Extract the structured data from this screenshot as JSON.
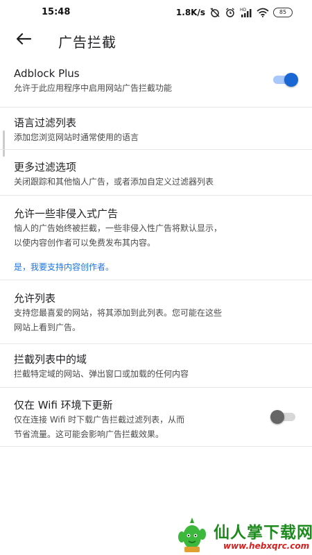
{
  "status_bar": {
    "time": "15:48",
    "net_speed": "1.8K/s",
    "battery_level": "85",
    "signal_label": "4G"
  },
  "header": {
    "title": "广告拦截"
  },
  "settings": {
    "adblock": {
      "title": "Adblock Plus",
      "description": "允许于此应用程序中启用网站广告拦截功能",
      "enabled": true
    },
    "language_filters": {
      "title": "语言过滤列表",
      "description": "添加您浏览网站时通常使用的语言"
    },
    "more_filters": {
      "title": "更多过滤选项",
      "description": "关闭跟踪和其他恼人广告，或者添加自定义过滤器列表"
    },
    "acceptable_ads": {
      "title": "允许一些非侵入式广告",
      "description_line1": "恼人的广告始终被拦截，一些非侵入性广告将默认显示，",
      "description_line2": "以使内容创作者可以免费发布其内容。",
      "link": "是，我要支持内容创作者。"
    },
    "allowlist": {
      "title": "允许列表",
      "description_line1": "支持您最喜爱的网站，将其添加到此列表。您可能在这些",
      "description_line2": "网站上看到广告。"
    },
    "blocked_domains": {
      "title": "拦截列表中的域",
      "description": "拦截特定域的网站、弹出窗口或加载的任何内容"
    },
    "wifi_only": {
      "title": "仅在 Wifi 环境下更新",
      "description_line1": "仅在连接 Wifi 时下载广告拦截过滤列表，从而",
      "description_line2": "节省流量。这可能会影响广告拦截效果。",
      "enabled": false
    }
  },
  "watermark": {
    "title": "仙人掌下载网",
    "url": "www.hebxqrc.com"
  },
  "colors": {
    "accent": "#1a66d2",
    "link": "#1a73e8",
    "watermark_green": "#1c8a1c",
    "watermark_red": "#d62020"
  },
  "icons": {
    "back": "arrow-left-icon",
    "alarm_off": "alarm-off-icon",
    "alarm": "alarm-icon",
    "signal": "signal-icon",
    "wifi": "wifi-icon",
    "battery": "battery-icon"
  }
}
